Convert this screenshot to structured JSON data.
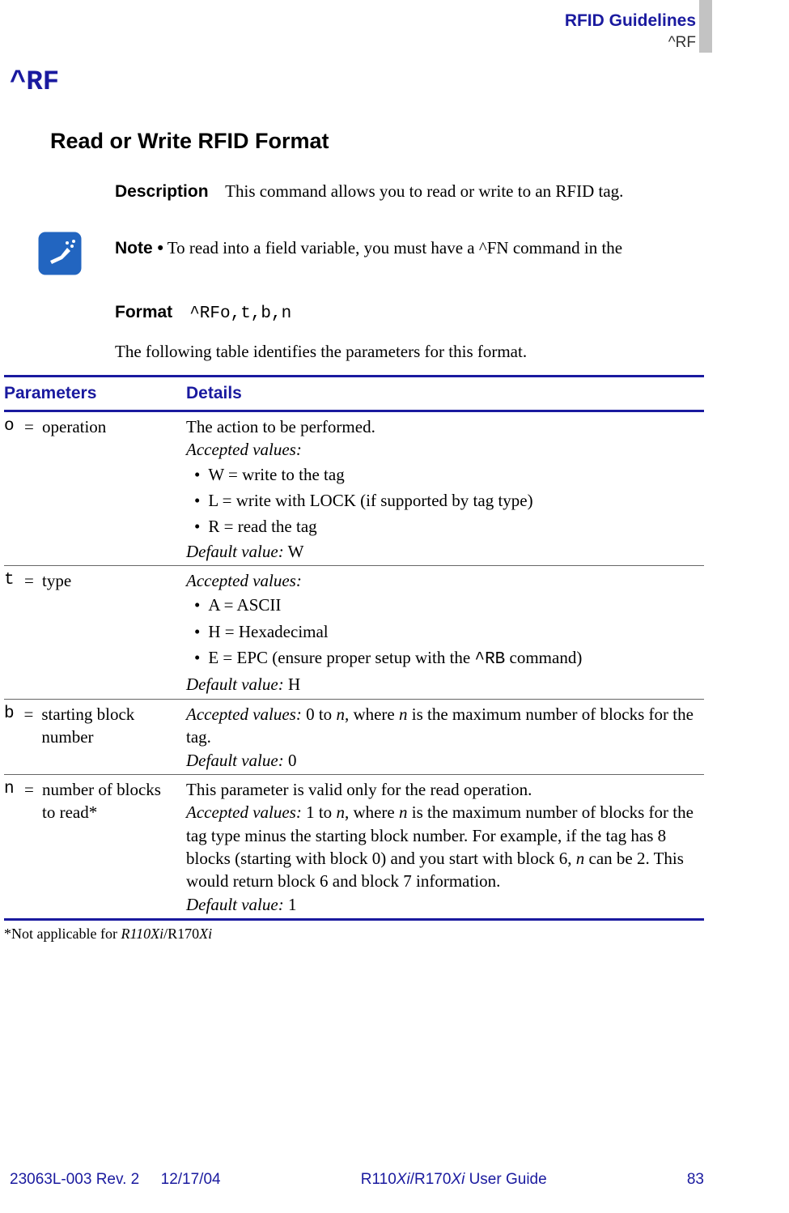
{
  "header": {
    "title": "RFID Guidelines",
    "subtitle": "^RF"
  },
  "cmd_heading": "^RF",
  "section_title": "Read or Write RFID Format",
  "desc": {
    "label": "Description",
    "text": "This command allows you to read or write to an RFID tag."
  },
  "note": {
    "label": "Note •",
    "text": "To read into a field variable, you must have a ^FN command in the"
  },
  "format": {
    "label": "Format",
    "code": "^RFo,t,b,n",
    "intro": "The following table identifies the parameters for this format."
  },
  "table": {
    "head": {
      "param": "Parameters",
      "details": "Details"
    },
    "rows": [
      {
        "letter": "o",
        "name": "operation",
        "line1": "The action to be performed.",
        "accepted_label": "Accepted values:",
        "bullets": [
          "W = write to the tag",
          "L = write with LOCK (if supported by tag type)",
          "R = read the tag"
        ],
        "default_label": "Default value:",
        "default_val": " W"
      },
      {
        "letter": "t",
        "name": "type",
        "accepted_label": "Accepted values:",
        "bullets": [
          "A = ASCII",
          "H = Hexadecimal"
        ],
        "bullet_e_prefix": "E = EPC (ensure proper setup with the ",
        "bullet_e_code": "^RB",
        "bullet_e_suffix": " command)",
        "default_label": "Default value:",
        "default_val": " H"
      },
      {
        "letter": "b",
        "name": "starting block number",
        "accepted_label": "Accepted values:",
        "accepted_prefix": " 0 to ",
        "accepted_n1": "n",
        "accepted_mid": ", where ",
        "accepted_n2": "n",
        "accepted_suffix": " is the maximum number of blocks for the tag.",
        "default_label": "Default value:",
        "default_val": " 0"
      },
      {
        "letter": "n",
        "name": "number of blocks to read*",
        "line1": "This parameter is valid only for the read operation.",
        "accepted_label": "Accepted values:",
        "accepted_prefix": " 1 to ",
        "accepted_n1": "n",
        "accepted_mid": ", where ",
        "accepted_n2": "n",
        "accepted_body": " is the maximum number of blocks for the tag type minus the starting block number. For example, if the tag has 8 blocks (starting with block 0) and you start with block 6, ",
        "accepted_n3": "n",
        "accepted_tail": " can be 2. This would return block 6 and block 7 information.",
        "default_label": "Default value:",
        "default_val": " 1"
      }
    ],
    "footnote_prefix": "*Not applicable for ",
    "footnote_ital1": "R110Xi",
    "footnote_slash": "/R170",
    "footnote_ital2": "Xi"
  },
  "footer": {
    "left_rev": "23063L-003 Rev. 2",
    "left_date": "12/17/04",
    "center_prefix": "R110",
    "center_xi1": "Xi",
    "center_mid": "/R170",
    "center_xi2": "Xi",
    "center_suffix": " User Guide",
    "page": "83"
  }
}
